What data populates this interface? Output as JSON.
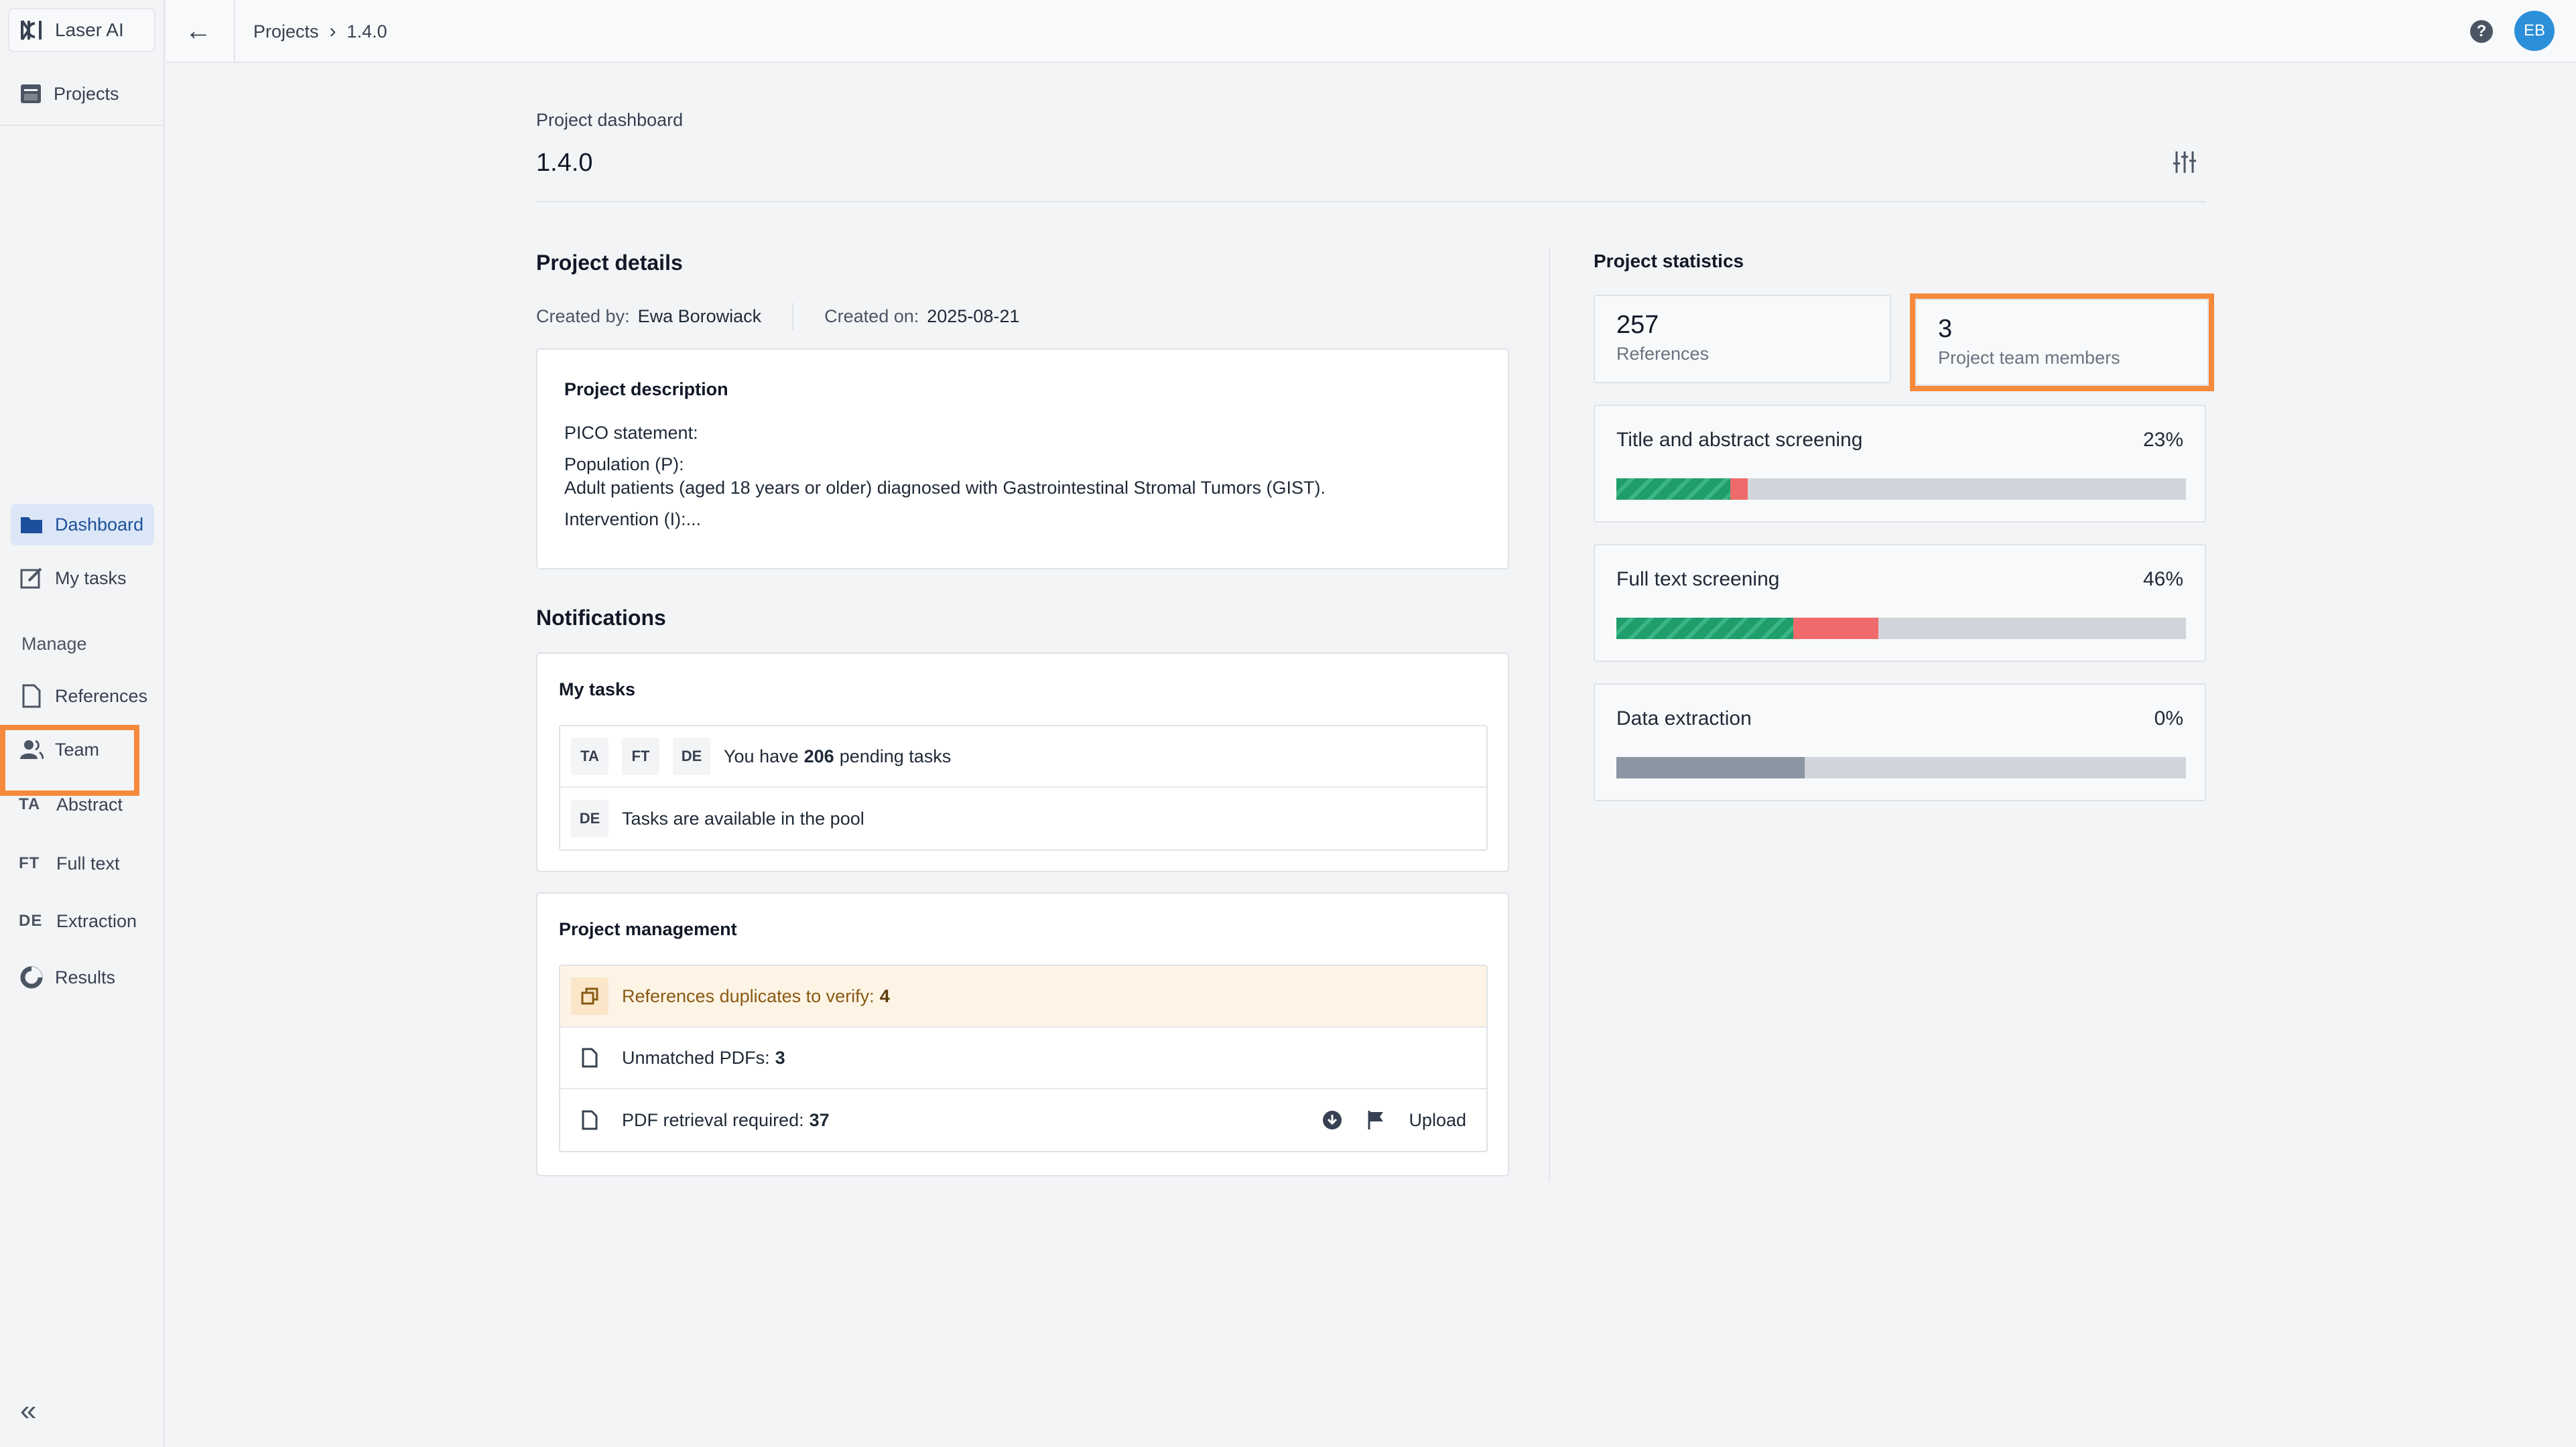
{
  "app": {
    "name": "Laser AI"
  },
  "sidebar": {
    "projects_label": "Projects",
    "nav": [
      {
        "label": "Dashboard",
        "icon": "folder-icon",
        "active": true
      },
      {
        "label": "My tasks",
        "icon": "edit-icon",
        "active": false
      }
    ],
    "manage_heading": "Manage",
    "manage": [
      {
        "label": "References",
        "icon": "document-icon"
      },
      {
        "label": "Team",
        "icon": "users-icon"
      },
      {
        "label": "Abstract",
        "abbr": "TA"
      },
      {
        "label": "Full text",
        "abbr": "FT"
      },
      {
        "label": "Extraction",
        "abbr": "DE"
      },
      {
        "label": "Results",
        "icon": "pie-chart-icon"
      }
    ],
    "collapse_icon": "double-chevron-left-icon"
  },
  "topbar": {
    "breadcrumb": [
      "Projects",
      "1.4.0"
    ],
    "user_initials": "EB",
    "help_icon": "question-circle-icon"
  },
  "dashboard": {
    "label": "Project dashboard",
    "title": "1.4.0"
  },
  "details": {
    "heading": "Project details",
    "created_by_label": "Created by:",
    "created_by": "Ewa Borowiack",
    "created_on_label": "Created on:",
    "created_on": "2025-08-21",
    "description_title": "Project description",
    "description_lines": [
      "PICO statement:",
      "Population (P):",
      "Adult patients (aged 18 years or older) diagnosed with Gastrointestinal Stromal Tumors (GIST).",
      "Intervention (I):..."
    ]
  },
  "notifications": {
    "heading": "Notifications",
    "my_tasks": {
      "title": "My tasks",
      "row1_chips": [
        "TA",
        "FT",
        "DE"
      ],
      "row1_prefix": "You have",
      "row1_count": "206",
      "row1_suffix": "pending tasks",
      "row2_chip": "DE",
      "row2_text": "Tasks are available in the pool"
    },
    "management": {
      "title": "Project management",
      "duplicates_label": "References duplicates to verify:",
      "duplicates_count": "4",
      "unmatched_label": "Unmatched PDFs:",
      "unmatched_count": "3",
      "retrieval_label": "PDF retrieval required:",
      "retrieval_count": "37",
      "upload_label": "Upload"
    }
  },
  "statistics": {
    "heading": "Project statistics",
    "references_count": "257",
    "references_label": "References",
    "members_count": "3",
    "members_label": "Project team members",
    "progress": [
      {
        "label": "Title and abstract screening",
        "percent_text": "23%",
        "done": 0.2,
        "excluded": 0.03
      },
      {
        "label": "Full text screening",
        "percent_text": "46%",
        "done": 0.31,
        "excluded": 0.15
      },
      {
        "label": "Data extraction",
        "percent_text": "0%",
        "done": 0.0,
        "excluded": 0.0,
        "pending": 0.33
      }
    ]
  },
  "colors": {
    "accent": "#1e4f9c",
    "highlight": "#f58a3c",
    "progress_green": "#1f9d6b",
    "progress_red": "#ef6b6b",
    "progress_track": "#d1d5db"
  }
}
